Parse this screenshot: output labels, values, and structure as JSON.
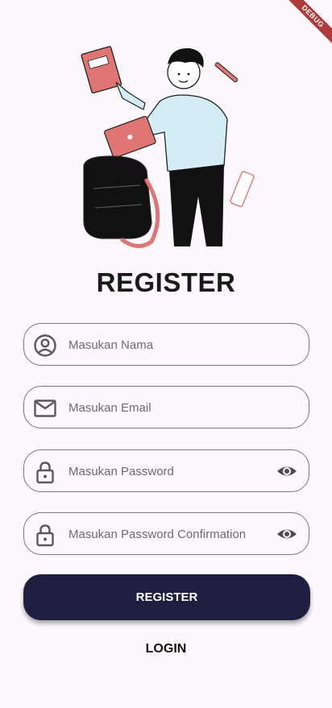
{
  "debug_banner": "DEBUG",
  "title": "REGISTER",
  "fields": {
    "name": {
      "placeholder": "Masukan Nama",
      "icon": "account-circle-icon"
    },
    "email": {
      "placeholder": "Masukan Email",
      "icon": "mail-icon"
    },
    "password": {
      "placeholder": "Masukan Password",
      "icon": "lock-icon",
      "toggle_icon": "eye-icon"
    },
    "password_confirmation": {
      "placeholder": "Masukan Password Confirmation",
      "icon": "lock-icon",
      "toggle_icon": "eye-icon"
    }
  },
  "register_button": "REGISTER",
  "login_button": "LOGIN",
  "colors": {
    "primary": "#1e1f40",
    "background": "#fdf8fd",
    "accent": "#e07673"
  }
}
